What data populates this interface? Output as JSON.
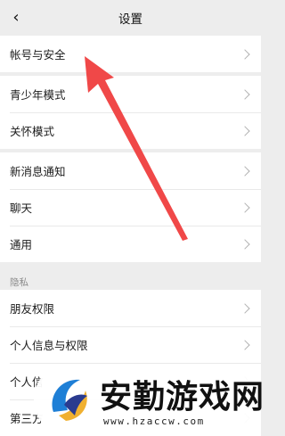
{
  "header": {
    "back_icon": "‹",
    "title": "设置"
  },
  "groups": [
    {
      "items": [
        {
          "label": "帐号与安全"
        }
      ]
    },
    {
      "items": [
        {
          "label": "青少年模式"
        },
        {
          "label": "关怀模式"
        }
      ]
    },
    {
      "items": [
        {
          "label": "新消息通知"
        },
        {
          "label": "聊天"
        },
        {
          "label": "通用"
        }
      ]
    },
    {
      "section_label": "隐私",
      "items": [
        {
          "label": "朋友权限"
        },
        {
          "label": "个人信息与权限"
        },
        {
          "label": "个人信"
        },
        {
          "label": "第三方"
        }
      ]
    }
  ],
  "annotation": {
    "color": "#f04848",
    "icon": "red-arrow-pointing-up-left"
  },
  "watermark": {
    "text": "安勤游戏网",
    "url": "www.hzaccw.com",
    "logo_colors": [
      "#1e7fd6",
      "#f0b030",
      "#2a3b8f"
    ]
  }
}
